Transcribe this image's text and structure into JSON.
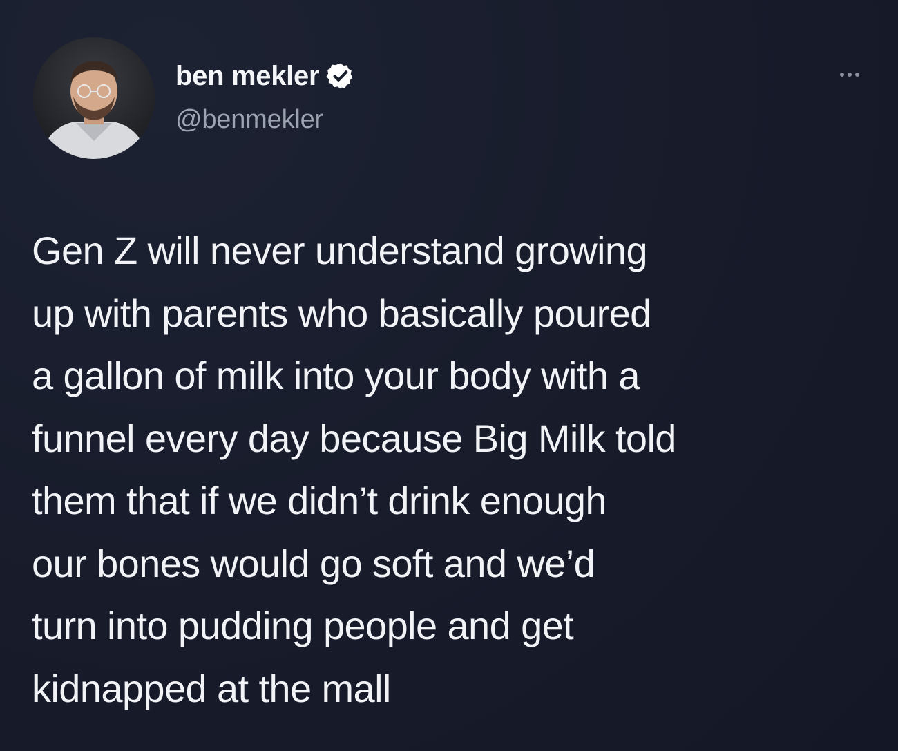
{
  "tweet": {
    "author": {
      "display_name": "ben mekler",
      "handle": "@benmekler",
      "verified": true,
      "avatar_icon": "profile-photo"
    },
    "more_icon": "more-options-icon",
    "text_lines": [
      "Gen Z will never understand growing",
      "up with parents who basically poured",
      "a gallon of milk into your body with a",
      "funnel every day because Big Milk told",
      "them that if we didn’t drink enough",
      "our bones would go soft and we’d",
      "turn into pudding people and get",
      "kidnapped at the mall"
    ]
  },
  "colors": {
    "background": "#171b2a",
    "text_primary": "#f2f3f6",
    "text_secondary": "#9da3b0",
    "verified_badge": "#ffffff"
  }
}
